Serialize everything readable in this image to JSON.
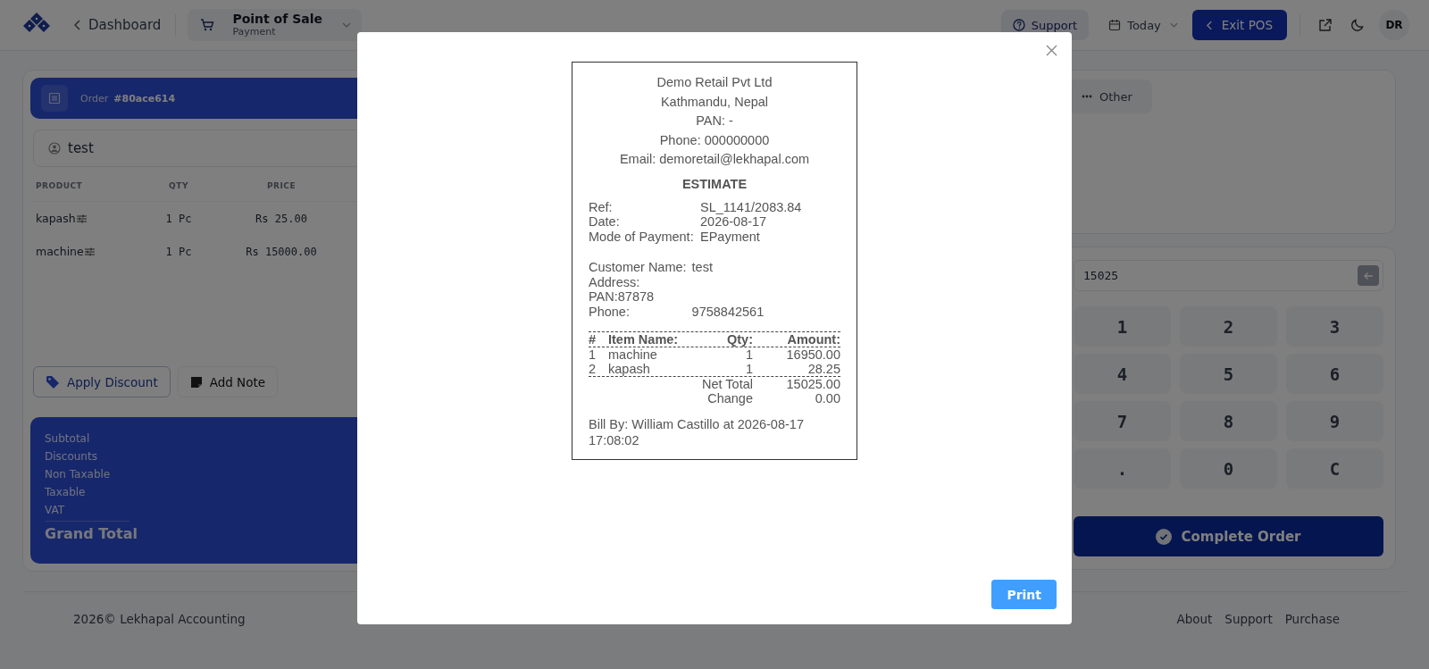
{
  "header": {
    "back_link": "Dashboard",
    "module": {
      "title": "Point of Sale",
      "subtitle": "Payment"
    },
    "support": "Support",
    "date_filter": "Today",
    "exit_button": "Exit POS",
    "avatar": "DR"
  },
  "order": {
    "label": "Order",
    "number": "#80ace614",
    "customer": "test",
    "table": {
      "columns": [
        "PRODUCT",
        "QTY",
        "PRICE"
      ],
      "rows": [
        {
          "product": "kapash",
          "qty": "1 Pc",
          "price": "Rs 25.00"
        },
        {
          "product": "machine",
          "qty": "1 Pc",
          "price": "Rs 15000.00"
        }
      ]
    },
    "actions": [
      {
        "label": "Apply Discount",
        "kind": "discount"
      },
      {
        "label": "Add Note",
        "kind": "note"
      }
    ],
    "summary": {
      "rows": [
        "Subtotal",
        "Discounts",
        "Non Taxable",
        "Taxable",
        "VAT"
      ],
      "grand_total": "Grand Total"
    }
  },
  "payment": {
    "methods": [
      {
        "label": "Other"
      }
    ],
    "amount": "15025",
    "keypad": [
      "1",
      "2",
      "3",
      "4",
      "5",
      "6",
      "7",
      "8",
      "9",
      ".",
      "0",
      "C"
    ],
    "complete_button": "Complete Order"
  },
  "footer": {
    "copyright": "2026© Lekhapal Accounting",
    "links": [
      "About",
      "Support",
      "Purchase"
    ]
  },
  "receipt_modal": {
    "print_button": "Print",
    "receipt": {
      "company": [
        "Demo Retail Pvt Ltd",
        "Kathmandu, Nepal",
        "PAN: -",
        "Phone: 000000000",
        "Email: demoretail@lekhapal.com"
      ],
      "doc_title": "ESTIMATE",
      "details": [
        {
          "label": "Ref:",
          "value": "SL_1141/2083.84"
        },
        {
          "label": "Date:",
          "value": "2026-08-17"
        },
        {
          "label": "Mode of Payment:",
          "value": "EPayment"
        }
      ],
      "customer": [
        {
          "label": "Customer Name:",
          "value": "test"
        },
        {
          "label": "Address:"
        },
        {
          "label": "PAN:87878"
        },
        {
          "label": "Phone:",
          "value": "9758842561"
        }
      ],
      "items_columns": [
        "#",
        "Item Name:",
        "Qty:",
        "Amount:"
      ],
      "items": [
        {
          "no": "1",
          "name": "machine",
          "qty": "1",
          "amount": "16950.00"
        },
        {
          "no": "2",
          "name": "kapash",
          "qty": "1",
          "amount": "28.25"
        }
      ],
      "totals": [
        {
          "label": "Net Total",
          "value": "15025.00"
        },
        {
          "label": "Change",
          "value": "0.00"
        }
      ],
      "bill_by": "Bill By: William Castillo at 2026-08-17 17:08:02"
    }
  }
}
